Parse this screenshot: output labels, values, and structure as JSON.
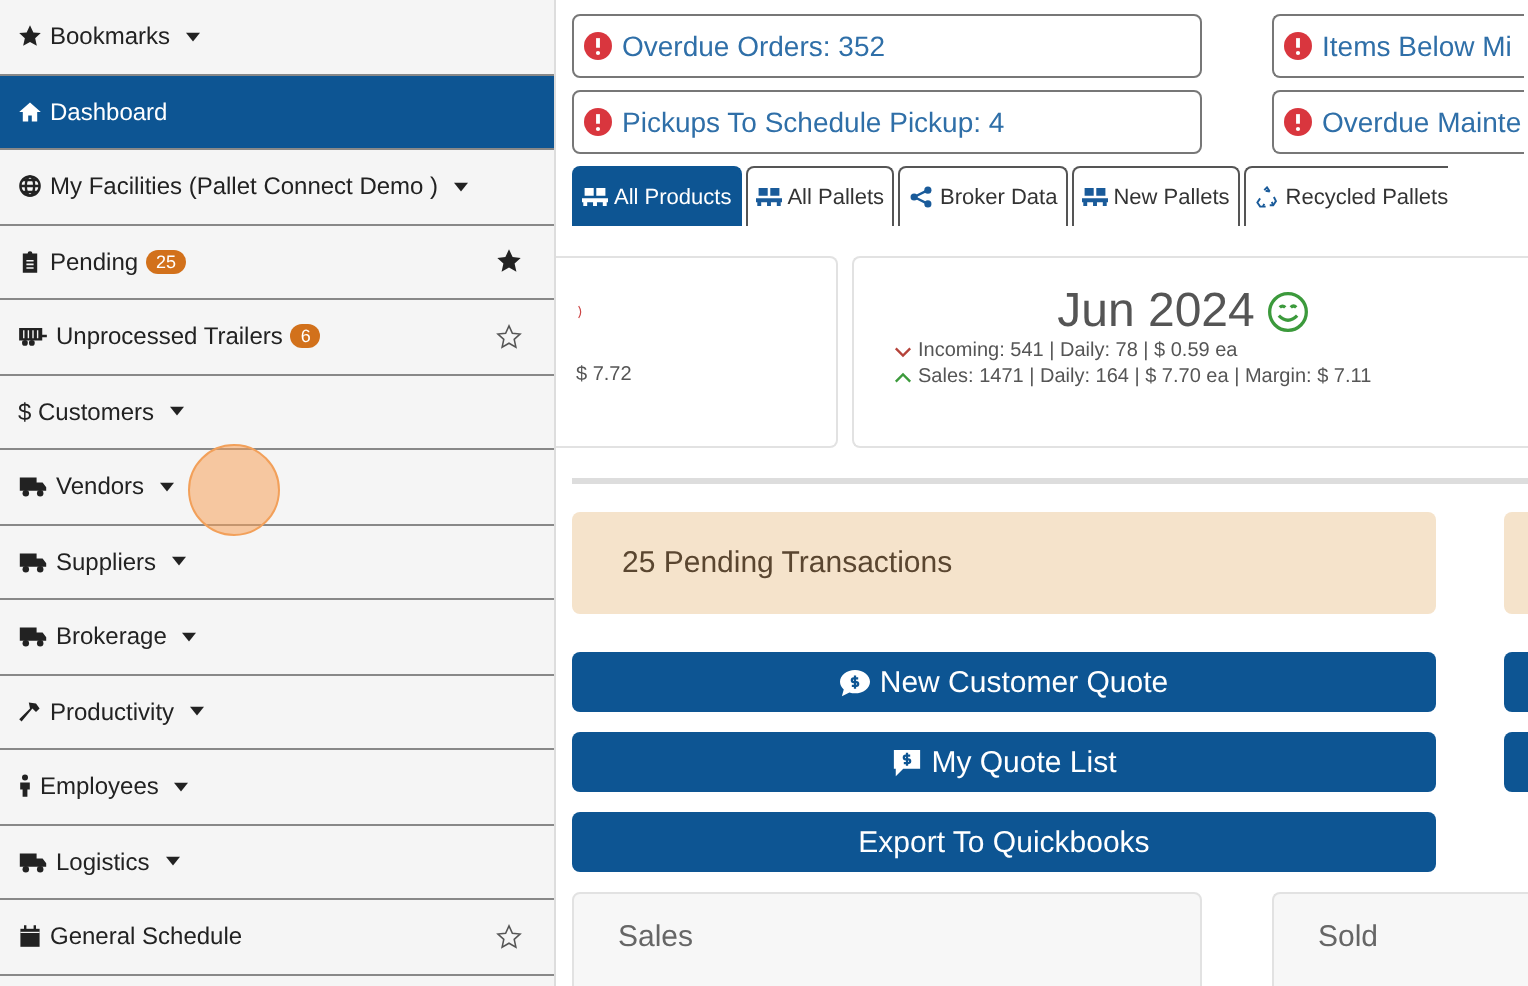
{
  "sidebar": {
    "items": [
      {
        "label": "Bookmarks",
        "dropdown": true,
        "selected": false
      },
      {
        "label": "Dashboard",
        "dropdown": false,
        "selected": true
      },
      {
        "label": "My Facilities (Pallet Connect Demo )",
        "dropdown": true,
        "selected": false
      },
      {
        "label": "Pending",
        "dropdown": false,
        "badge": "25",
        "starred": true,
        "selected": false
      },
      {
        "label": "Unprocessed Trailers",
        "dropdown": false,
        "badge": "6",
        "starred": false,
        "selected": false
      },
      {
        "label": "$ Customers",
        "dropdown": true,
        "selected": false
      },
      {
        "label": "Vendors",
        "dropdown": true,
        "selected": false
      },
      {
        "label": "Suppliers",
        "dropdown": true,
        "selected": false
      },
      {
        "label": "Brokerage",
        "dropdown": true,
        "selected": false
      },
      {
        "label": "Productivity",
        "dropdown": true,
        "selected": false
      },
      {
        "label": "Employees",
        "dropdown": true,
        "selected": false
      },
      {
        "label": "Logistics",
        "dropdown": true,
        "selected": false
      },
      {
        "label": "General Schedule",
        "dropdown": false,
        "starred": false,
        "selected": false
      }
    ]
  },
  "alerts": [
    {
      "text": "Overdue Orders: 352"
    },
    {
      "text": "Items Below Mi"
    },
    {
      "text": "Pickups To Schedule Pickup: 4"
    },
    {
      "text": "Overdue Mainte"
    }
  ],
  "tabs": [
    {
      "label": "All Products",
      "selected": true
    },
    {
      "label": "All Pallets",
      "selected": false
    },
    {
      "label": "Broker Data",
      "selected": false
    },
    {
      "label": "New Pallets",
      "selected": false
    },
    {
      "label": "Recycled Pallets",
      "selected": false
    }
  ],
  "stat_cards": [
    {
      "lines": [
        "$ 7.72"
      ]
    },
    {
      "title": "Jun 2024",
      "lines": [
        "Incoming: 541 | Daily: 78 | $ 0.59 ea",
        "Sales: 1471 | Daily: 164 | $ 7.70 ea | Margin: $ 7.11"
      ]
    }
  ],
  "pending_panel": {
    "text": "25 Pending Transactions"
  },
  "buttons": [
    {
      "label": "New Customer Quote"
    },
    {
      "label": "My Quote List"
    },
    {
      "label": "Export To Quickbooks"
    }
  ],
  "panels": [
    {
      "title": "Sales"
    },
    {
      "title": "Sold"
    }
  ]
}
